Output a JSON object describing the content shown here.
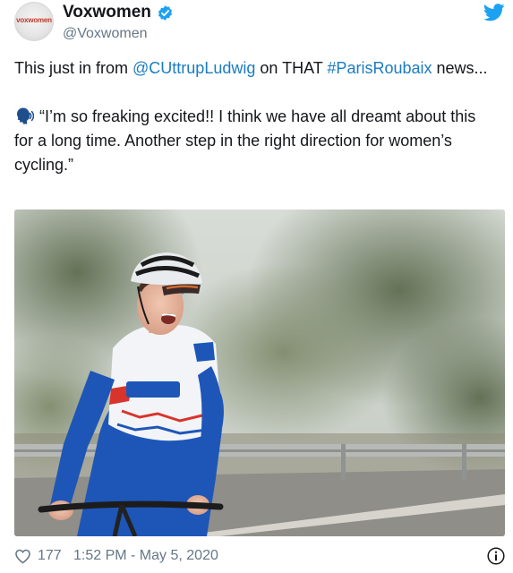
{
  "account": {
    "display_name": "Voxwomen",
    "handle": "@Voxwomen",
    "avatar_text": "voxwomen",
    "verified": true
  },
  "tweet": {
    "line1_prefix": "This just in from ",
    "mention": "@CUttrupLudwig",
    "line1_middle": " on THAT ",
    "hashtag": "#ParisRoubaix",
    "line1_suffix": " news...",
    "quote_icon": "speaking-head-icon",
    "quote": "“I’m so freaking excited!! I think we have all dreamt about this for a long time. Another step in the right direction for women’s cycling.”"
  },
  "media": {
    "type": "photo",
    "subject": "cyclist-in-blue-and-white-jersey"
  },
  "footer": {
    "likes": "177",
    "timestamp": "1:52 PM - May 5, 2020"
  },
  "colors": {
    "link": "#1b7cc1",
    "verified": "#1da1f2",
    "twitter_blue": "#1da1f2",
    "muted": "#657786"
  }
}
